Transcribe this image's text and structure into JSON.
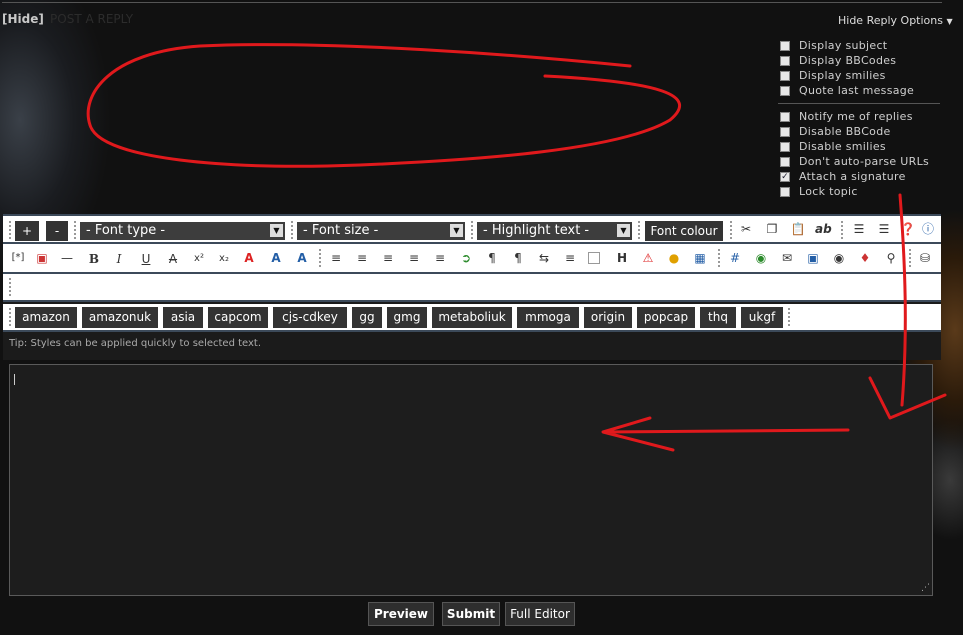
{
  "header": {
    "hide_label": "[Hide]",
    "title": "POST A REPLY",
    "hide_options": "Hide Reply Options"
  },
  "options_group1": [
    {
      "label": "Display subject",
      "checked": false
    },
    {
      "label": "Display BBCodes",
      "checked": false
    },
    {
      "label": "Display smilies",
      "checked": false
    },
    {
      "label": "Quote last message",
      "checked": false
    }
  ],
  "options_group2": [
    {
      "label": "Notify me of replies",
      "checked": false
    },
    {
      "label": "Disable BBCode",
      "checked": false
    },
    {
      "label": "Disable smilies",
      "checked": false
    },
    {
      "label": "Don't auto-parse URLs",
      "checked": false
    },
    {
      "label": "Attach a signature",
      "checked": true
    },
    {
      "label": "Lock topic",
      "checked": false
    }
  ],
  "toolbar": {
    "plus": "+",
    "minus": "-",
    "font_type": "- Font type -",
    "font_size": "- Font size -",
    "highlight": "- Highlight text -",
    "font_colour": "Font colour",
    "list_item": "[*]"
  },
  "custom_codes": [
    "amazon",
    "amazonuk",
    "asia",
    "capcom",
    "cjs-cdkey",
    "gg",
    "gmg",
    "metaboliuk",
    "mmoga",
    "origin",
    "popcap",
    "thq",
    "ukgf"
  ],
  "tip": "Tip: Styles can be applied quickly to selected text.",
  "buttons": {
    "preview": "Preview",
    "submit": "Submit",
    "full_editor": "Full Editor"
  },
  "annotation_color": "#e0191c"
}
